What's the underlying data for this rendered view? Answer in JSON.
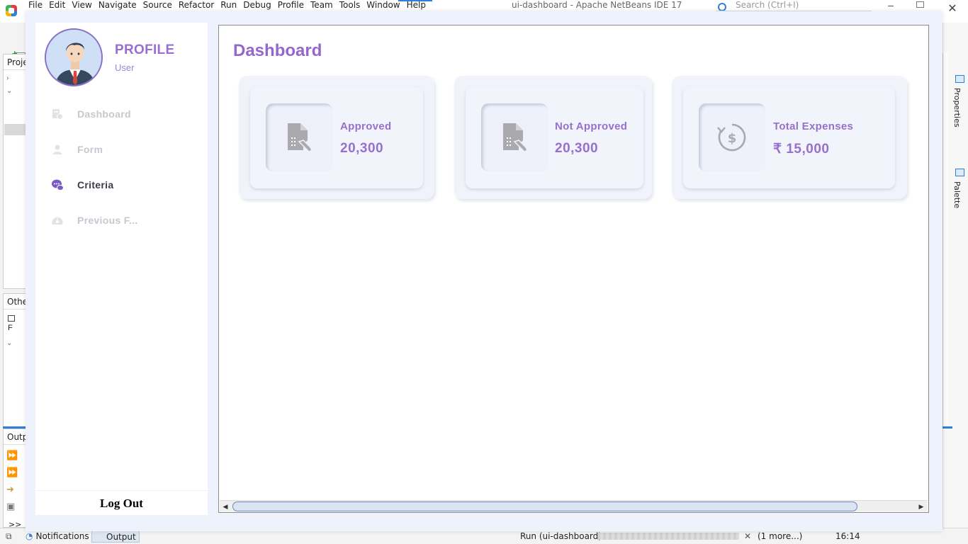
{
  "ide": {
    "menu": [
      "File",
      "Edit",
      "View",
      "Navigate",
      "Source",
      "Refactor",
      "Run",
      "Debug",
      "Profile",
      "Team",
      "Tools",
      "Window",
      "Help"
    ],
    "title": "ui-dashboard - Apache NetBeans IDE 17",
    "search_placeholder": "Search (Ctrl+I)",
    "projects_tab": "Proje",
    "other_tab": "Othe",
    "other_file": "F",
    "output_tab": "Outp",
    "right_tabs": [
      "Properties",
      "Palette"
    ],
    "status": {
      "notifications": "Notifications",
      "output": "Output",
      "run_task": "Run (ui-dashboard)",
      "more": "(1 more...)",
      "time": "16:14",
      "chevron": ">>"
    }
  },
  "app": {
    "profile": {
      "title": "PROFILE",
      "role": "User"
    },
    "nav": [
      {
        "label": "Dashboard",
        "icon": "dashboard-icon",
        "active": false
      },
      {
        "label": "Form",
        "icon": "user-icon",
        "active": false
      },
      {
        "label": "Criteria",
        "icon": "chat-icon",
        "active": true
      },
      {
        "label": "Previous F...",
        "icon": "history-icon",
        "active": false
      }
    ],
    "logout_label": "Log Out",
    "page_title": "Dashboard",
    "cards": [
      {
        "label": "Approved",
        "value": "20,300",
        "icon": "document-edit-icon"
      },
      {
        "label": "Not Approved",
        "value": "20,300",
        "icon": "document-edit-icon"
      },
      {
        "label": "Total Expenses",
        "value": "₹ 15,000",
        "icon": "money-history-icon"
      }
    ],
    "colors": {
      "accent": "#9670cc",
      "background": "#edf2fc",
      "card": "#f1f3fb"
    }
  }
}
